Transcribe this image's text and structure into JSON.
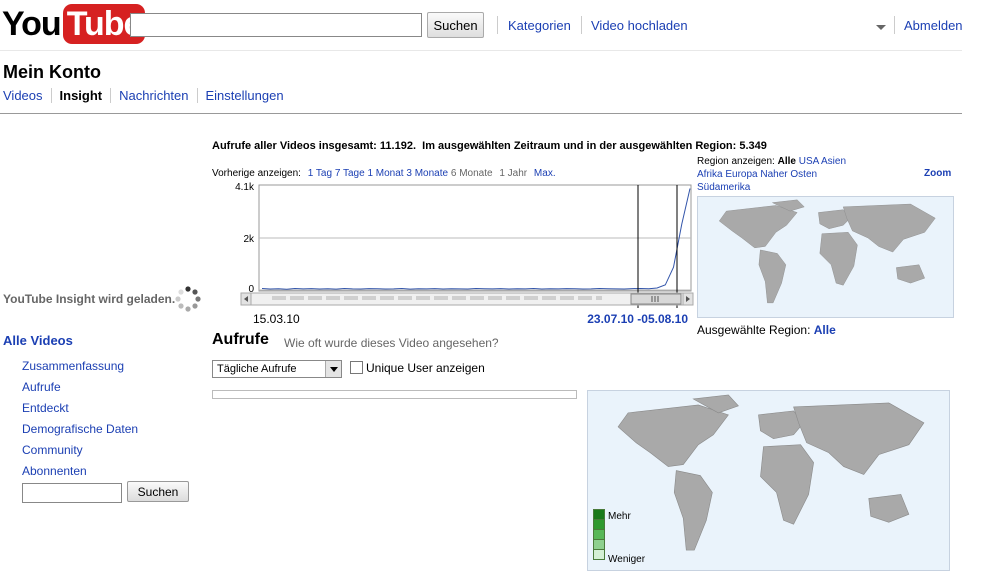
{
  "header": {
    "logo_you": "You",
    "logo_tube": "Tube",
    "search_placeholder": "",
    "search_button": "Suchen",
    "links": [
      "Kategorien",
      "Video hochladen"
    ],
    "signout": "Abmelden"
  },
  "page": {
    "title": "Mein Konto",
    "tabs": [
      {
        "label": "Videos",
        "active": false
      },
      {
        "label": "Insight",
        "active": true
      },
      {
        "label": "Nachrichten",
        "active": false
      },
      {
        "label": "Einstellungen",
        "active": false
      }
    ]
  },
  "stats": {
    "total_label": "Aufrufe aller Videos insgesamt:",
    "total_value": "11.192.",
    "range_label": "Im ausgewählten Zeitraum und in der ausgewählten Region:",
    "range_value": "5.349"
  },
  "range": {
    "label": "Vorherige anzeigen:",
    "options": [
      {
        "label": "1 Tag",
        "link": true
      },
      {
        "label": "7 Tage",
        "link": true
      },
      {
        "label": "1 Monat",
        "link": true
      },
      {
        "label": "3 Monate",
        "link": true
      },
      {
        "label": "6 Monate",
        "link": false
      },
      {
        "label": "1 Jahr",
        "link": false
      },
      {
        "label": "Max.",
        "link": true
      }
    ]
  },
  "chart_data": {
    "type": "line",
    "yticks": [
      "4.1k",
      "2k",
      "0"
    ],
    "ylim": [
      0,
      4100
    ],
    "x_start_label": "15.03.10",
    "selection_label": "23.07.10 -05.08.10",
    "values": [
      60,
      40,
      50,
      30,
      60,
      45,
      55,
      40,
      50,
      35,
      60,
      45,
      40,
      55,
      50,
      40,
      45,
      60,
      35,
      50,
      45,
      55,
      40,
      50,
      45,
      40,
      60,
      50,
      45,
      55,
      40,
      50,
      45,
      60,
      40,
      50,
      45,
      55,
      50,
      40,
      45,
      60,
      50,
      45,
      40,
      55,
      60,
      50,
      80,
      200,
      900,
      2600,
      4000
    ]
  },
  "region": {
    "label": "Region anzeigen:",
    "current": "Alle",
    "links": [
      "USA",
      "Asien",
      "Afrika",
      "Europa",
      "Naher Osten",
      "Südamerika"
    ],
    "zoom": "Zoom",
    "selected_label": "Ausgewählte Region:",
    "selected_value": "Alle"
  },
  "sidebar": {
    "loading": "YouTube Insight wird geladen.",
    "all_videos": "Alle Videos",
    "items": [
      "Zusammenfassung",
      "Aufrufe",
      "Entdeckt",
      "Demografische Daten",
      "Community",
      "Abonnenten"
    ],
    "search_button": "Suchen"
  },
  "aufrufe": {
    "title": "Aufrufe",
    "description": "Wie oft wurde dieses Video angesehen?",
    "select_value": "Tägliche Aufrufe",
    "unique_label": "Unique User anzeigen"
  },
  "legend": {
    "more": "Mehr",
    "less": "Weniger",
    "colors": [
      "#1a7a1a",
      "#2f9a2f",
      "#58b858",
      "#8ed08e",
      "#d4efd4"
    ]
  },
  "colors": {
    "logo_red": "#d62121",
    "link": "#1b3fb3",
    "land": "#a9a9a9",
    "ocean": "#eaf3fb"
  }
}
